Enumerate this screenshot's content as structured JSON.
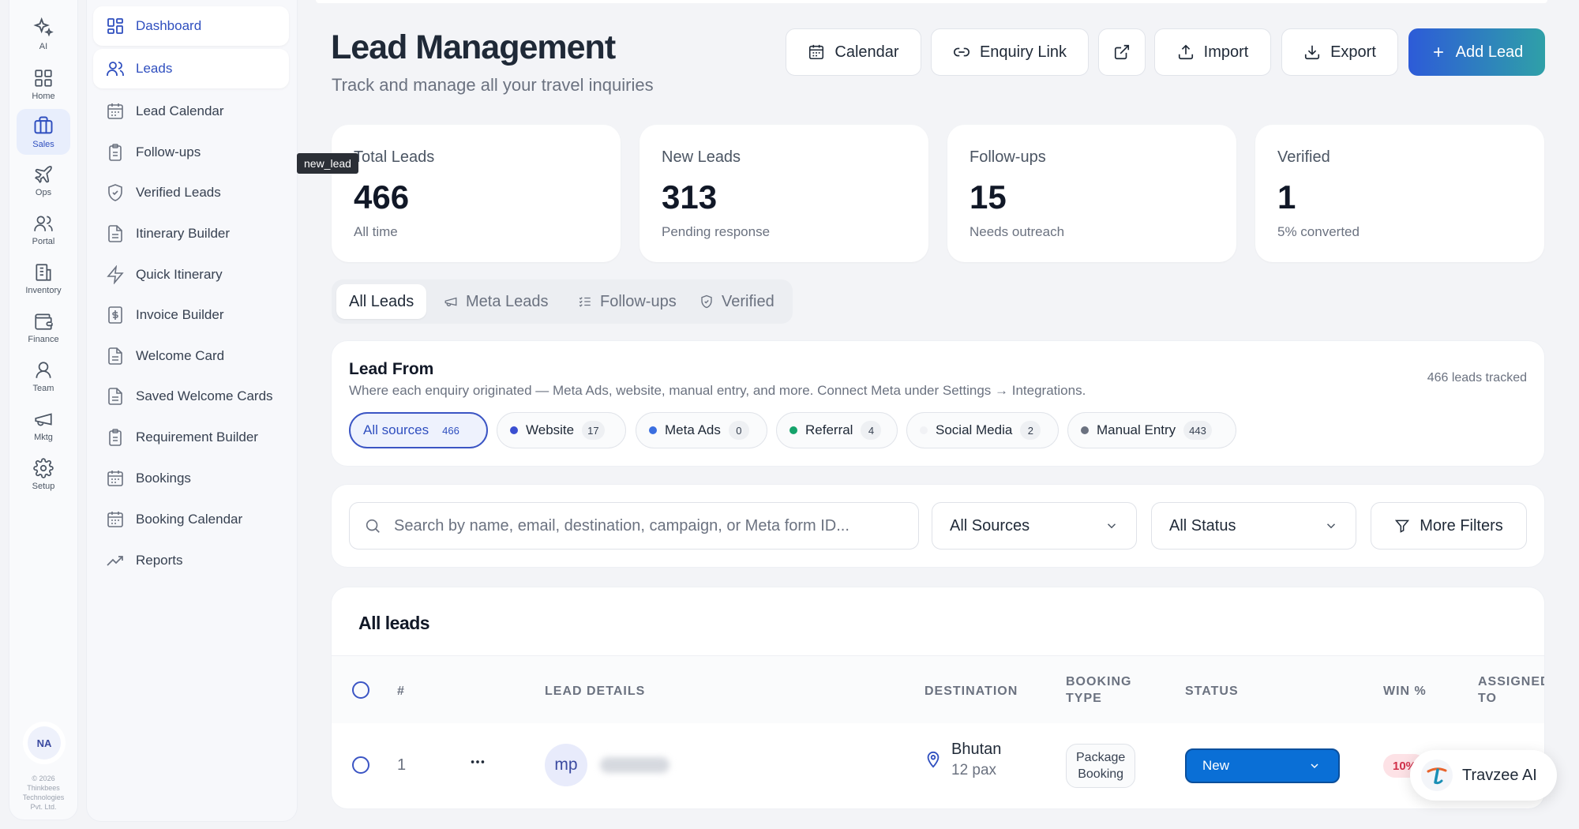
{
  "rail": {
    "items": [
      {
        "label": "AI",
        "icon": "sparkle-icon"
      },
      {
        "label": "Home",
        "icon": "grid-icon"
      },
      {
        "label": "Sales",
        "icon": "briefcase-icon",
        "active": true
      },
      {
        "label": "Ops",
        "icon": "plane-icon"
      },
      {
        "label": "Portal",
        "icon": "users-icon"
      },
      {
        "label": "Inventory",
        "icon": "building-icon"
      },
      {
        "label": "Finance",
        "icon": "wallet-icon"
      },
      {
        "label": "Team",
        "icon": "team-icon"
      },
      {
        "label": "Mktg",
        "icon": "megaphone-icon"
      },
      {
        "label": "Setup",
        "icon": "gear-icon"
      }
    ],
    "avatar": "NA",
    "copyright": "© 2026 Thinkbees Technologies Pvt. Ltd."
  },
  "submenu": {
    "items": [
      {
        "label": "Dashboard",
        "icon": "dashboard-icon"
      },
      {
        "label": "Leads",
        "icon": "leads-icon"
      },
      {
        "label": "Lead Calendar",
        "icon": "calendar-icon"
      },
      {
        "label": "Follow-ups",
        "icon": "clipboard-icon"
      },
      {
        "label": "Verified Leads",
        "icon": "shield-check-icon"
      },
      {
        "label": "Itinerary Builder",
        "icon": "document-icon"
      },
      {
        "label": "Quick Itinerary",
        "icon": "lightning-icon"
      },
      {
        "label": "Invoice Builder",
        "icon": "invoice-icon"
      },
      {
        "label": "Welcome Card",
        "icon": "document-icon"
      },
      {
        "label": "Saved Welcome Cards",
        "icon": "document-icon"
      },
      {
        "label": "Requirement Builder",
        "icon": "clipboard-icon"
      },
      {
        "label": "Bookings",
        "icon": "calendar-icon"
      },
      {
        "label": "Booking Calendar",
        "icon": "calendar-icon"
      },
      {
        "label": "Reports",
        "icon": "trend-icon"
      }
    ]
  },
  "tooltip": "new_lead",
  "header": {
    "title": "Lead Management",
    "subtitle": "Track and manage all your travel inquiries",
    "buttons": {
      "calendar": "Calendar",
      "enquiry_link": "Enquiry Link",
      "import": "Import",
      "export": "Export",
      "add_lead": "Add Lead"
    }
  },
  "stats": [
    {
      "label": "Total Leads",
      "value": "466",
      "sub": "All time"
    },
    {
      "label": "New Leads",
      "value": "313",
      "sub": "Pending response"
    },
    {
      "label": "Follow-ups",
      "value": "15",
      "sub": "Needs outreach"
    },
    {
      "label": "Verified",
      "value": "1",
      "sub": "5% converted"
    }
  ],
  "tabs": [
    {
      "label": "All Leads",
      "active": true
    },
    {
      "label": "Meta Leads",
      "icon": "megaphone-icon"
    },
    {
      "label": "Follow-ups",
      "icon": "list-check-icon"
    },
    {
      "label": "Verified",
      "icon": "shield-check-icon"
    }
  ],
  "lead_from": {
    "title": "Lead From",
    "description": "Where each enquiry originated — Meta Ads, website, manual entry, and more. Connect Meta under Settings → Integrations.",
    "tracked": "466 leads tracked",
    "chips": [
      {
        "label": "All sources",
        "count": "466",
        "active": true
      },
      {
        "label": "Website",
        "count": "17",
        "color": "#3b4fd1"
      },
      {
        "label": "Meta Ads",
        "count": "0",
        "color": "#3b6fe0"
      },
      {
        "label": "Referral",
        "count": "4",
        "color": "#15a36b"
      },
      {
        "label": "Social Media",
        "count": "2",
        "color": "#f1f2f5"
      },
      {
        "label": "Manual Entry",
        "count": "443",
        "color": "#6b7280"
      }
    ]
  },
  "filters": {
    "search_placeholder": "Search by name, email, destination, campaign, or Meta form ID...",
    "sources": "All Sources",
    "status": "All Status",
    "more": "More Filters"
  },
  "table": {
    "title": "All leads",
    "columns": {
      "num": "#",
      "details": "LEAD DETAILS",
      "destination": "DESTINATION",
      "booking_type_1": "BOOKING",
      "booking_type_2": "TYPE",
      "status": "STATUS",
      "win": "WIN %",
      "assigned_1": "ASSIGNED",
      "assigned_2": "TO"
    },
    "rows": [
      {
        "num": "1",
        "initials": "mp",
        "destination": "Bhutan",
        "pax": "12 pax",
        "booking_type_1": "Package",
        "booking_type_2": "Booking",
        "status": "New",
        "win": "10%"
      }
    ]
  },
  "ai_widget": "Travzee AI",
  "colors": {
    "accent": "#2f4fbf",
    "status_blue": "#0a6fd6",
    "win_red": "#d1314b"
  }
}
